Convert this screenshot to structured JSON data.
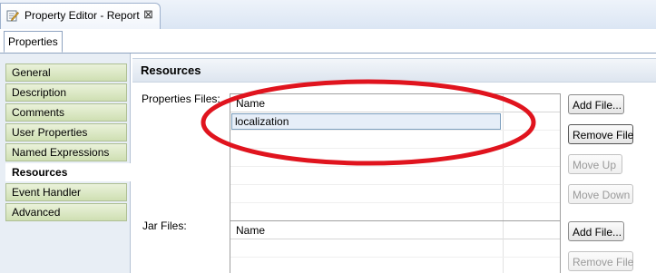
{
  "editor_tab": {
    "title": "Property Editor - Report",
    "close_glyph": "⊠",
    "icon": "property-editor-icon"
  },
  "sub_tab": {
    "label": "Properties"
  },
  "sidebar": {
    "items": [
      {
        "label": "General",
        "selected": false
      },
      {
        "label": "Description",
        "selected": false
      },
      {
        "label": "Comments",
        "selected": false
      },
      {
        "label": "User Properties",
        "selected": false
      },
      {
        "label": "Named Expressions",
        "selected": false
      },
      {
        "label": "Resources",
        "selected": true
      },
      {
        "label": "Event Handler",
        "selected": false
      },
      {
        "label": "Advanced",
        "selected": false
      }
    ]
  },
  "section": {
    "title": "Resources"
  },
  "properties_files": {
    "label": "Properties Files:",
    "column_name": "Name",
    "rows": [
      "localization"
    ],
    "buttons": {
      "add": "Add File...",
      "remove": "Remove File",
      "move_up": "Move Up",
      "move_down": "Move Down"
    }
  },
  "jar_files": {
    "label": "Jar Files:",
    "column_name": "Name",
    "buttons": {
      "add": "Add File...",
      "remove": "Remove File"
    }
  },
  "colors": {
    "annotation": "#e0141e",
    "sidebar_item": "#dbe7c6",
    "header_bg": "#e4ebf3"
  }
}
